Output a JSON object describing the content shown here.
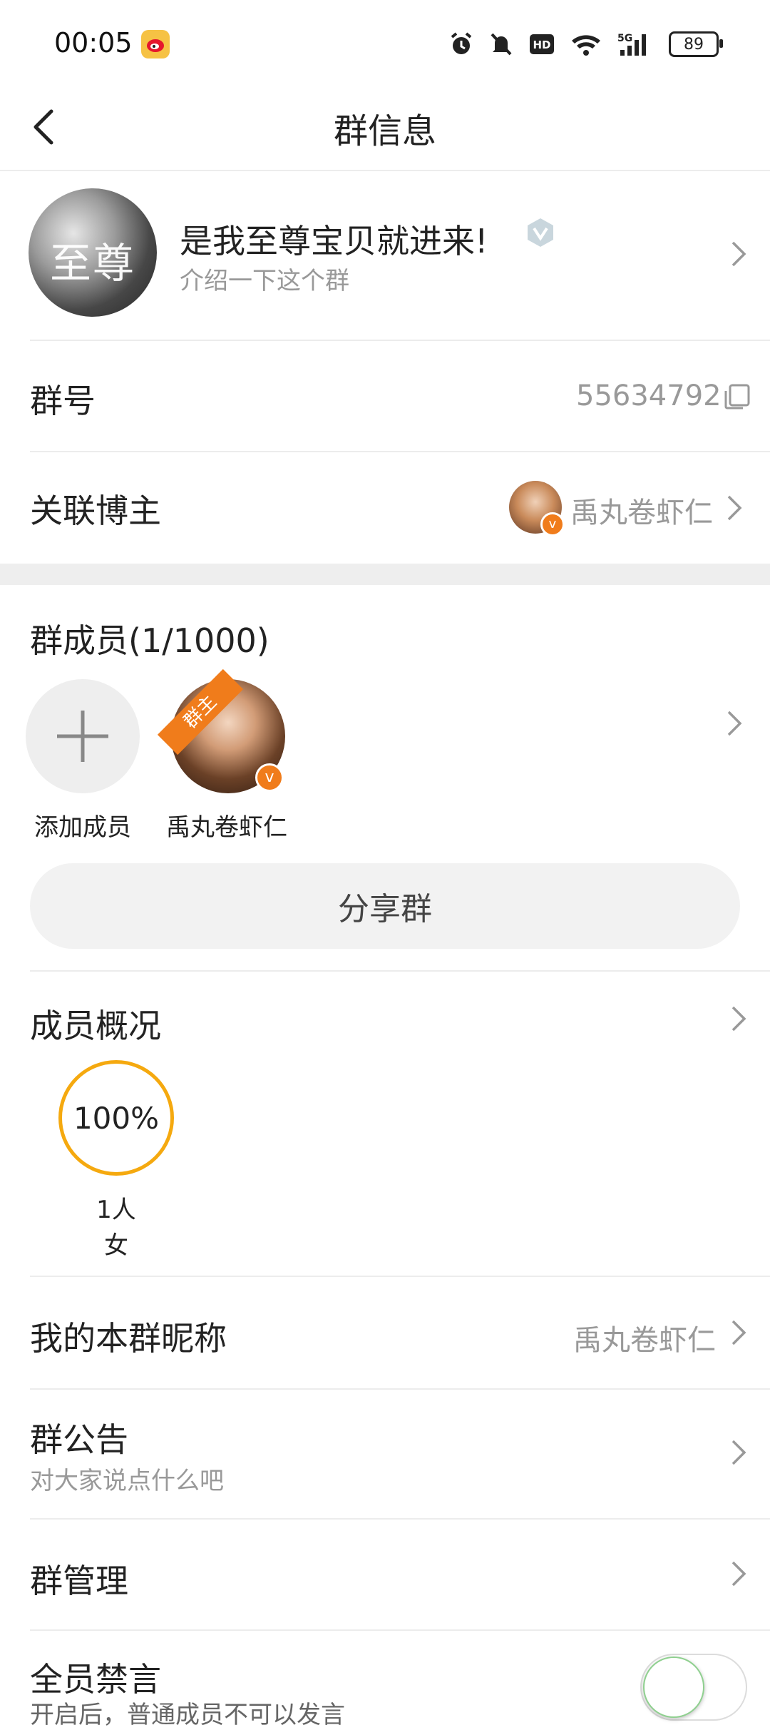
{
  "status_bar": {
    "time": "00:05",
    "battery": "89",
    "icons": [
      "weibo-icon",
      "alarm-icon",
      "mute-icon",
      "hd-icon",
      "wifi-icon",
      "5g-signal-icon",
      "battery-icon"
    ]
  },
  "header": {
    "title": "群信息"
  },
  "group": {
    "avatar_text": "至尊",
    "name": "是我至尊宝贝就进来!",
    "description": "介绍一下这个群"
  },
  "group_number": {
    "label": "群号",
    "value": "55634792"
  },
  "linked_blogger": {
    "label": "关联博主",
    "name": "禹丸卷虾仁"
  },
  "members": {
    "title": "群成员(1/1000)",
    "add_label": "添加成员",
    "owner_tag": "群主",
    "list": [
      {
        "name": "禹丸卷虾仁"
      }
    ]
  },
  "share_button": "分享群",
  "member_overview": {
    "title": "成员概况",
    "percent": "100%",
    "count": "1人",
    "gender": "女",
    "ring_color": "#f5a90f"
  },
  "my_nickname": {
    "label": "我的本群昵称",
    "value": "禹丸卷虾仁"
  },
  "announcement": {
    "label": "群公告",
    "sub": "对大家说点什么吧"
  },
  "management": {
    "label": "群管理"
  },
  "mute_all": {
    "label": "全员禁言",
    "sub": "开启后，普通成员不可以发言",
    "enabled": false
  },
  "colors": {
    "accent": "#f5a90f",
    "verify_badge": "#f07c1b",
    "text_secondary": "#999999"
  }
}
